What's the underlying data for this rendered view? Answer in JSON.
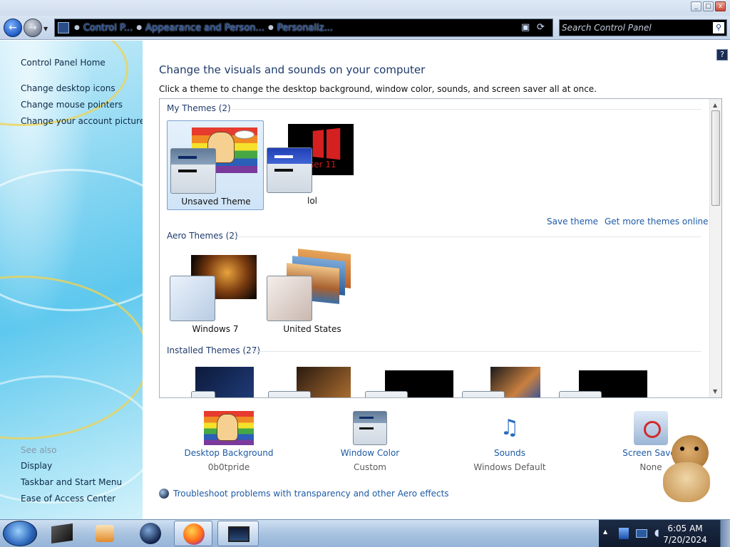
{
  "window": {
    "buttons": {
      "minimize": "_",
      "maximize": "□",
      "close": "x"
    }
  },
  "nav": {
    "back": "←",
    "forward": "→",
    "breadcrumbs": [
      "Control P...",
      "Appearance and Person...",
      "Personaliz..."
    ],
    "search_placeholder": "Search Control Panel"
  },
  "sidebar": {
    "home": "Control Panel Home",
    "links": [
      "Change desktop icons",
      "Change mouse pointers",
      "Change your account picture"
    ],
    "see_also_heading": "See also",
    "see_also": [
      "Display",
      "Taskbar and Start Menu",
      "Ease of Access Center"
    ]
  },
  "main": {
    "title": "Change the visuals and sounds on your computer",
    "subtitle": "Click a theme to change the desktop background, window color, sounds, and screen saver all at once.",
    "groups": {
      "my_themes": "My Themes (2)",
      "aero_themes": "Aero Themes (2)",
      "installed_themes": "Installed Themes (27)"
    },
    "my_themes": [
      {
        "label": "Unsaved Theme",
        "selected": true
      },
      {
        "label": "lol",
        "selected": false
      }
    ],
    "aero_themes": [
      {
        "label": "Windows 7"
      },
      {
        "label": "United States"
      }
    ],
    "save_theme": "Save theme",
    "get_more": "Get more themes online",
    "lol_thumb_text": "ser 11"
  },
  "settings": [
    {
      "link": "Desktop Background",
      "sub": "0b0tpride"
    },
    {
      "link": "Window Color",
      "sub": "Custom"
    },
    {
      "link": "Sounds",
      "sub": "Windows Default"
    },
    {
      "link": "Screen Saver",
      "sub": "None"
    }
  ],
  "troubleshoot": "Troubleshoot problems with transparency and other Aero effects",
  "taskbar": {
    "time": "6:05 AM",
    "date": "7/20/2024"
  },
  "colors": {
    "link": "#1d5aa5",
    "heading": "#1e3a6b",
    "selected_tile": "#cfe4f7"
  }
}
